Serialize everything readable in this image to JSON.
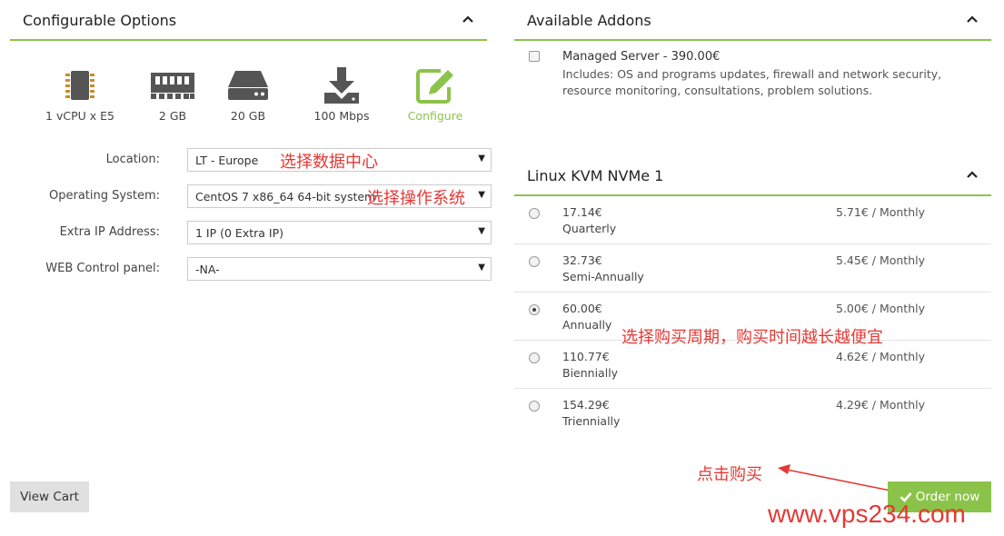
{
  "configurable": {
    "title": "Configurable Options",
    "specs": [
      {
        "icon": "cpu-chip-icon",
        "label": "1 vCPU x E5"
      },
      {
        "icon": "ram-module-icon",
        "label": "2 GB"
      },
      {
        "icon": "hard-drive-icon",
        "label": "20 GB"
      },
      {
        "icon": "download-icon",
        "label": "100 Mbps"
      },
      {
        "icon": "edit-icon",
        "label": "Configure"
      }
    ],
    "options": [
      {
        "label": "Location:",
        "value": "LT - Europe"
      },
      {
        "label": "Operating System:",
        "value": "CentOS 7 x86_64 64-bit system"
      },
      {
        "label": "Extra IP Address:",
        "value": "1 IP (0 Extra IP)"
      },
      {
        "label": "WEB Control panel:",
        "value": "-NA-"
      }
    ]
  },
  "addons": {
    "title": "Available Addons",
    "items": [
      {
        "title": "Managed Server - 390.00€",
        "description": "Includes: OS and programs updates, firewall and network security, resource monitoring, consultations, problem solutions."
      }
    ]
  },
  "billing": {
    "title": "Linux KVM NVMe 1",
    "cycles": [
      {
        "price": "17.14€",
        "period": "Quarterly",
        "monthly": "5.71€ / Monthly",
        "selected": false
      },
      {
        "price": "32.73€",
        "period": "Semi-Annually",
        "monthly": "5.45€ / Monthly",
        "selected": false
      },
      {
        "price": "60.00€",
        "period": "Annually",
        "monthly": "5.00€ / Monthly",
        "selected": true
      },
      {
        "price": "110.77€",
        "period": "Biennially",
        "monthly": "4.62€ / Monthly",
        "selected": false
      },
      {
        "price": "154.29€",
        "period": "Triennially",
        "monthly": "4.29€ / Monthly",
        "selected": false
      }
    ]
  },
  "buttons": {
    "view_cart": "View Cart",
    "order_now": "Order now"
  },
  "annotations": {
    "datacenter": "选择数据中心",
    "os": "选择操作系统",
    "cycle": "选择购买周期，购买时间越长越便宜",
    "buy": "点击购买"
  },
  "watermark": "www.vps234.com",
  "colors": {
    "accent": "#8bc34a",
    "annotation": "#e53935"
  }
}
